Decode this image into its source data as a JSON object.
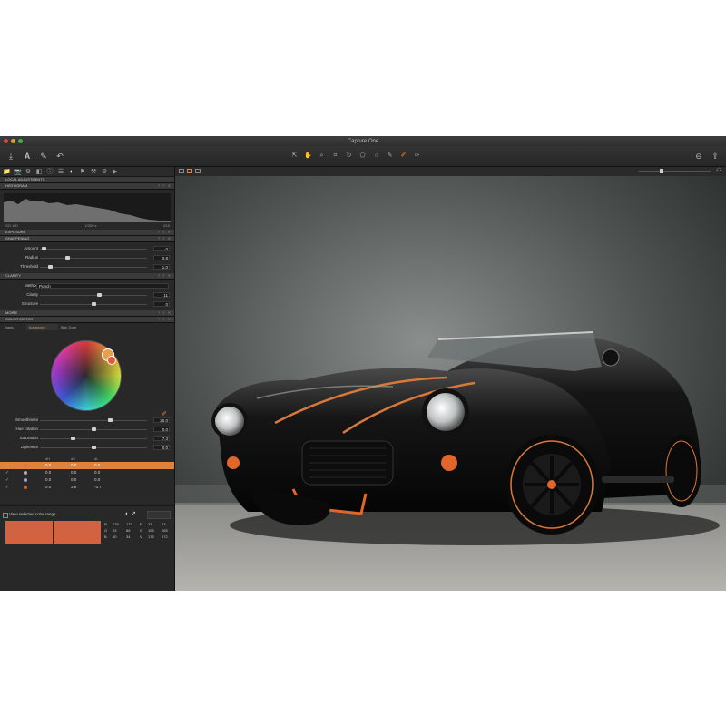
{
  "window": {
    "title": "Capture One",
    "traffic_lights": [
      "#e0443e",
      "#e0a32a",
      "#3fb14a"
    ]
  },
  "toolbar": {
    "import_icon": "download-icon",
    "text_icon": "text-A-icon",
    "tools": [
      {
        "icon": "cursor-icon",
        "glyph": "⇱"
      },
      {
        "icon": "hand-icon",
        "glyph": "✋"
      },
      {
        "icon": "zoom-icon",
        "glyph": "⌕"
      },
      {
        "icon": "crop-icon",
        "glyph": "⌗"
      },
      {
        "icon": "rotate-icon",
        "glyph": "↻"
      },
      {
        "icon": "keystone-icon",
        "glyph": "⬠"
      },
      {
        "icon": "spot-icon",
        "glyph": "○"
      },
      {
        "icon": "brush-icon",
        "glyph": "✎"
      },
      {
        "icon": "color-picker-icon",
        "glyph": "✐"
      },
      {
        "icon": "white-balance-icon",
        "glyph": "✑"
      }
    ]
  },
  "sidebar": {
    "tool_tabs": [
      "📁",
      "📷",
      "⚙",
      "◧",
      "ⓘ",
      "☰",
      "◐",
      "⚑",
      "⚒",
      "⚙",
      "▶"
    ],
    "sections": {
      "local_adjustments": "LOCAL ADJUSTMENTS",
      "histogram": "HISTOGRAM",
      "exposure": "EXPOSURE",
      "sharpening": "SHARPENING",
      "clarity": "CLARITY",
      "moire": "MOIRE",
      "color_editor": "COLOR EDITOR"
    },
    "histogram": {
      "iso": "ISO 100",
      "shutter": "1/200 s",
      "aperture": "f/10"
    },
    "sharpening": {
      "rows": [
        {
          "label": "Amount",
          "value": "0",
          "pos": 0.02
        },
        {
          "label": "Radius",
          "value": "0.8",
          "pos": 0.25
        },
        {
          "label": "Threshold",
          "value": "1.0",
          "pos": 0.08
        }
      ]
    },
    "clarity": {
      "method_label": "Method",
      "method_value": "Punch",
      "rows": [
        {
          "label": "Clarity",
          "value": "11",
          "pos": 0.56
        },
        {
          "label": "Structure",
          "value": "0",
          "pos": 0.5
        }
      ]
    },
    "color_editor": {
      "tabs": [
        "Basic",
        "Advanced",
        "Skin Tone"
      ],
      "active_tab": 1,
      "rows": [
        {
          "label": "Smoothness",
          "value": "20.0",
          "pos": 0.66
        },
        {
          "label": "Hue rotation",
          "value": "0.0",
          "pos": 0.5
        },
        {
          "label": "Saturation",
          "value": "7.3",
          "pos": 0.3
        },
        {
          "label": "Lightness",
          "value": "0.0",
          "pos": 0.5
        }
      ],
      "table_headers": [
        "dH",
        "dS",
        "dL"
      ],
      "table_rows": [
        {
          "color": "#d5783c",
          "values": [
            "0.0",
            "0.0",
            "0.0"
          ],
          "selected": true
        },
        {
          "color": "#b0b0b0",
          "values": [
            "0.0",
            "0.0",
            "0.0"
          ],
          "selected": false
        },
        {
          "color": "#8fa8c8",
          "values": [
            "0.0",
            "0.0",
            "0.0"
          ],
          "selected": false
        },
        {
          "color": "#d16342",
          "values": [
            "0.0",
            "2.6",
            "-3.7"
          ],
          "selected": false
        }
      ],
      "view_range_label": "View selected color range",
      "swatch_color": "#d16342",
      "readout": {
        "rows": [
          [
            "R",
            "175",
            "173",
            "R",
            "23",
            "23"
          ],
          [
            "G",
            "93",
            "86",
            "G",
            "195",
            "265"
          ],
          [
            "B",
            "40",
            "34",
            "V",
            "175",
            "172"
          ]
        ]
      }
    }
  },
  "viewer": {
    "view_modes": [
      "single",
      "multi",
      "grid"
    ],
    "active_mode": 1
  }
}
